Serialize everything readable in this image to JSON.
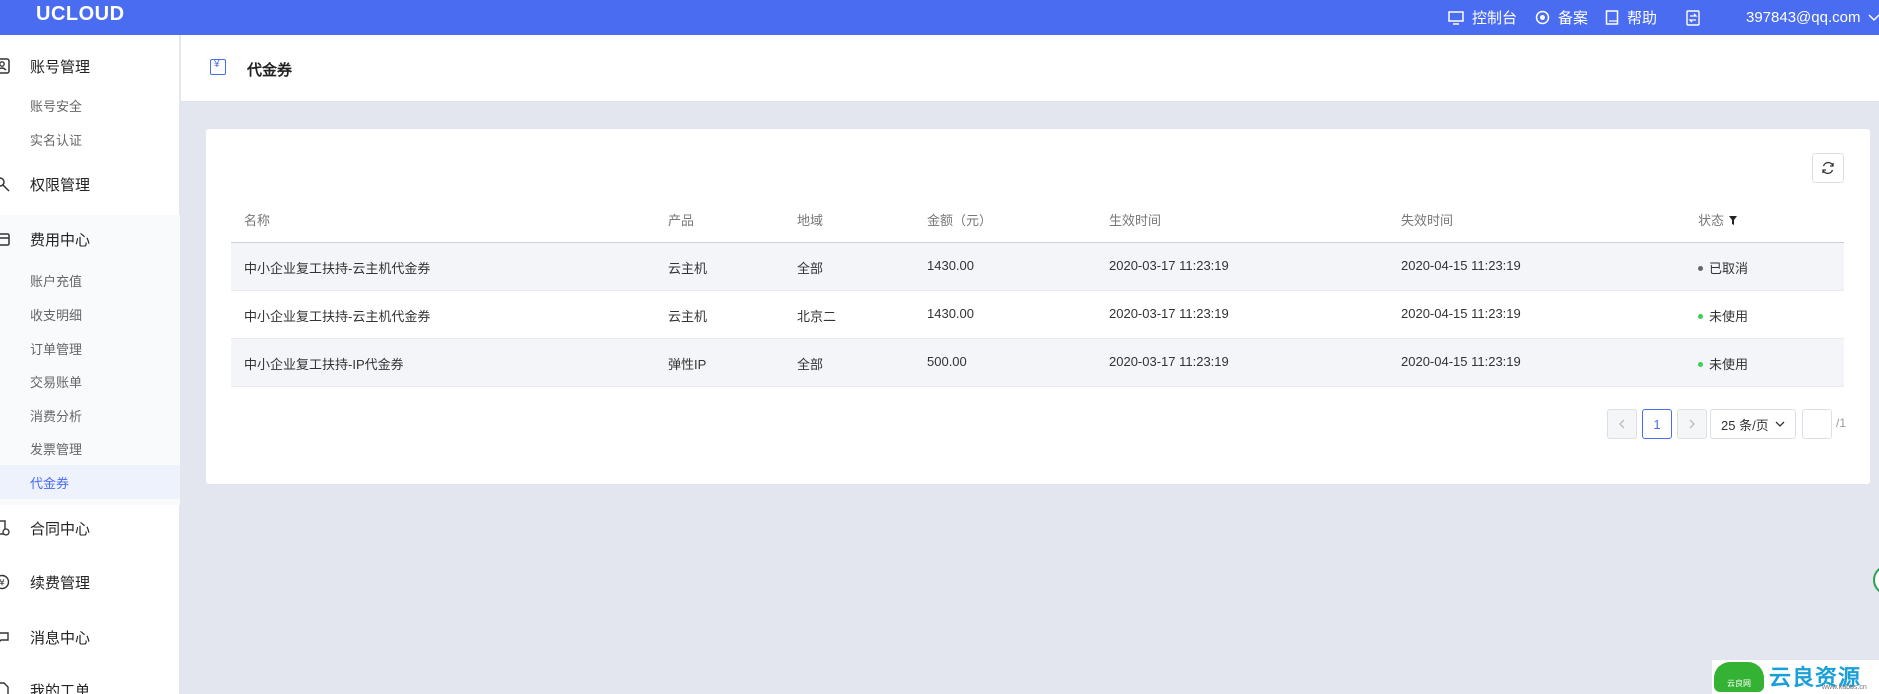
{
  "topbar": {
    "logo": "UCLOUD",
    "console": "控制台",
    "record": "备案",
    "help": "帮助",
    "user": "397843@qq.com"
  },
  "sidebar": {
    "account_group": "账号管理",
    "account_items": [
      "账号安全",
      "实名认证"
    ],
    "permission_group": "权限管理",
    "fee_group": "费用中心",
    "fee_items": [
      "账户充值",
      "收支明细",
      "订单管理",
      "交易账单",
      "消费分析",
      "发票管理",
      "代金券"
    ],
    "contract_group": "合同中心",
    "renew_group": "续费管理",
    "message_group": "消息中心",
    "ticket_group": "我的工单"
  },
  "header": {
    "title": "代金券"
  },
  "table": {
    "columns": [
      "名称",
      "产品",
      "地域",
      "金额（元）",
      "生效时间",
      "失效时间",
      "状态"
    ],
    "rows": [
      {
        "name": "中小企业复工扶持-云主机代金券",
        "product": "云主机",
        "region": "全部",
        "amount": "1430.00",
        "start": "2020-03-17 11:23:19",
        "end": "2020-04-15 11:23:19",
        "status": "已取消",
        "status_color": "#666666"
      },
      {
        "name": "中小企业复工扶持-云主机代金券",
        "product": "云主机",
        "region": "北京二",
        "amount": "1430.00",
        "start": "2020-03-17 11:23:19",
        "end": "2020-04-15 11:23:19",
        "status": "未使用",
        "status_color": "#3ccf57"
      },
      {
        "name": "中小企业复工扶持-IP代金券",
        "product": "弹性IP",
        "region": "全部",
        "amount": "500.00",
        "start": "2020-03-17 11:23:19",
        "end": "2020-04-15 11:23:19",
        "status": "未使用",
        "status_color": "#3ccf57"
      }
    ]
  },
  "pagination": {
    "current": "1",
    "page_size": "25 条/页",
    "total": "/1"
  },
  "watermark": {
    "text": "云良资源网",
    "url": "www.kubbs.cn",
    "small": "云良网"
  },
  "colors": {
    "accent": "#4a6cf0",
    "page_bg": "#e3e6ee"
  }
}
